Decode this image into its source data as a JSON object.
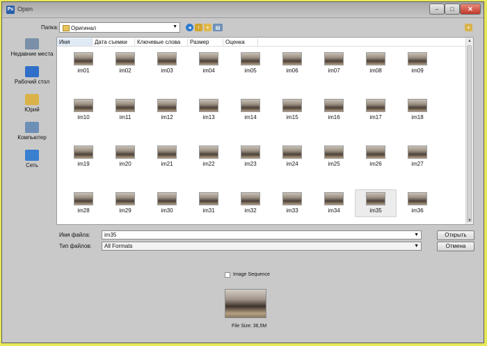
{
  "window": {
    "title": "Open",
    "app_icon": "Ps"
  },
  "folder": {
    "label": "Папка:",
    "current": "Оригинал"
  },
  "places": [
    {
      "label": "Недавние места",
      "icon": "recent-places-icon",
      "color": "#7a8fa8"
    },
    {
      "label": "Рабочий стол",
      "icon": "desktop-icon",
      "color": "#2f6fc8"
    },
    {
      "label": "Юрий",
      "icon": "user-folder-icon",
      "color": "#d9b24a"
    },
    {
      "label": "Компьютер",
      "icon": "computer-icon",
      "color": "#6e8fb5"
    },
    {
      "label": "Сеть",
      "icon": "network-icon",
      "color": "#3a7fd0"
    }
  ],
  "columns": [
    "Имя",
    "Дата съемки",
    "Ключевые слова",
    "Размер",
    "Оценка"
  ],
  "files": [
    "im01",
    "im02",
    "im03",
    "im04",
    "im05",
    "im06",
    "im07",
    "im08",
    "im09",
    "im10",
    "im11",
    "im12",
    "im13",
    "im14",
    "im15",
    "im16",
    "im17",
    "im18",
    "im19",
    "im20",
    "im21",
    "im22",
    "im23",
    "im24",
    "im25",
    "im26",
    "im27",
    "im28",
    "im29",
    "im30",
    "im31",
    "im32",
    "im33",
    "im34",
    "im35",
    "im36"
  ],
  "selected_file": "im35",
  "filename": {
    "label": "Имя файла:",
    "value": "im35"
  },
  "filetype": {
    "label": "Тип файлов:",
    "value": "All Formats"
  },
  "buttons": {
    "open": "Открыть",
    "cancel": "Отмена"
  },
  "image_sequence": {
    "label": "Image Sequence",
    "checked": false
  },
  "file_size": "File Size: 36,5M",
  "colors": {
    "background": "#e8e85a",
    "dialog": "#c9c9c9",
    "list": "#ffffff"
  }
}
